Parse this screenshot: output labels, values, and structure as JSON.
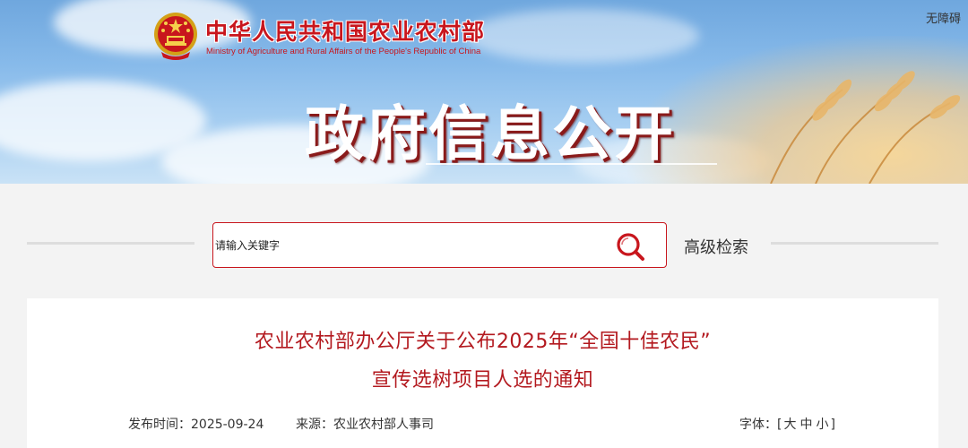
{
  "header": {
    "ministry_name_cn": "中华人民共和国农业农村部",
    "ministry_name_en": "Ministry of Agriculture and Rural Affairs of the People's Republic of China",
    "accessibility_label": "无障碍",
    "section_title": "政府信息公开",
    "emblem_icon": "national-emblem-icon"
  },
  "search": {
    "placeholder": "请输入关键字",
    "button_icon": "search-icon",
    "advanced_label": "高级检索"
  },
  "article": {
    "title_line1": "农业农村部办公厅关于公布2025年“全国十佳农民”",
    "title_line2": "宣传选树项目人选的通知",
    "publish_label": "发布时间：",
    "publish_date": "2025-09-24",
    "source_label": "来源：",
    "source_value": "农业农村部人事司",
    "font_size_label": "字体：",
    "font_size_open": "[",
    "font_sizes": [
      "大",
      "中",
      "小"
    ],
    "font_size_close": "]"
  },
  "colors": {
    "brand_red": "#c8161d",
    "title_red": "#b3191f",
    "page_bg": "#f3f3f3"
  }
}
